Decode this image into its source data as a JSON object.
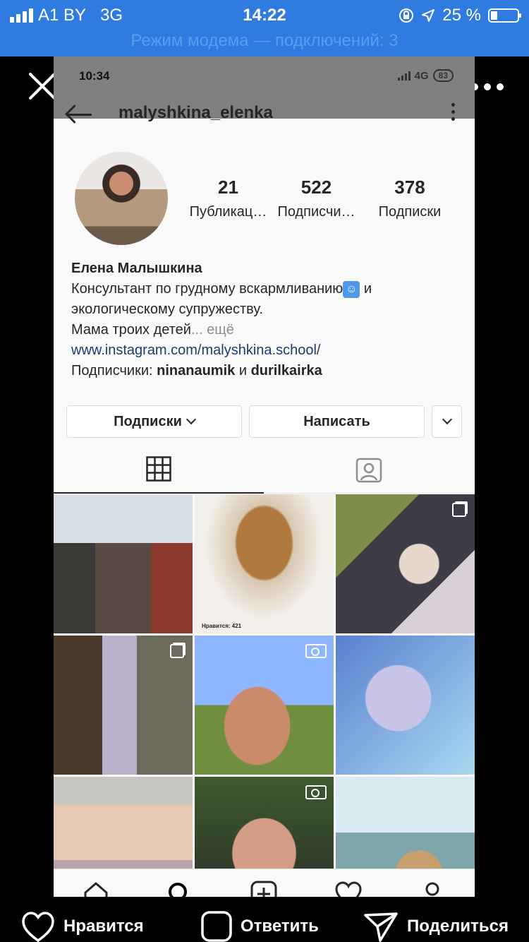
{
  "status_bar": {
    "carrier": "A1 BY",
    "network": "3G",
    "time": "14:22",
    "battery": "25 %",
    "battery_fraction": 0.25,
    "hotspot": "Режим модема — подключений: 3"
  },
  "inner_status": {
    "time": "10:34",
    "network": "4G",
    "battery": "83"
  },
  "profile": {
    "username": "malyshkina_elenka",
    "stats": [
      {
        "number": "21",
        "label": "Публикац…"
      },
      {
        "number": "522",
        "label": "Подписчи…"
      },
      {
        "number": "378",
        "label": "Подписки"
      }
    ],
    "name": "Елена Малышкина",
    "bio_line1": "Консультант по грудному вскармливанию",
    "bio_emoji": "👶",
    "bio_line1_end": " и",
    "bio_line2": "экологическому супружеству.",
    "bio_line3": "Мама троих детей",
    "bio_more": "... ещё",
    "link": "www.instagram.com/malyshkina.school/",
    "followers_prefix": "Подписчики: ",
    "follower1": "ninanaumik",
    "followers_and": " и ",
    "follower2": "durilkairka"
  },
  "actions": {
    "following": "Подписки",
    "message": "Написать"
  },
  "tabs": {
    "grid_icon": "grid-icon",
    "tagged_icon": "tagged-user-icon"
  },
  "posts": [
    {
      "type": "photo",
      "caption": ""
    },
    {
      "type": "photo",
      "caption": "Нравится: 421"
    },
    {
      "type": "carousel",
      "caption": ""
    },
    {
      "type": "carousel",
      "caption": ""
    },
    {
      "type": "video",
      "caption": ""
    },
    {
      "type": "photo",
      "caption": ""
    },
    {
      "type": "photo",
      "caption": ""
    },
    {
      "type": "video",
      "caption": ""
    },
    {
      "type": "photo",
      "caption": ""
    }
  ],
  "bottom_nav": [
    "home-icon",
    "search-icon",
    "add-post-icon",
    "activity-heart-icon",
    "profile-icon"
  ],
  "viewer_bar": {
    "like": "Нравится",
    "reply": "Ответить",
    "share": "Поделиться"
  },
  "colors": {
    "ios_blue": "#2f7be0",
    "link": "#1b3e6b",
    "ig_text": "#262626"
  }
}
